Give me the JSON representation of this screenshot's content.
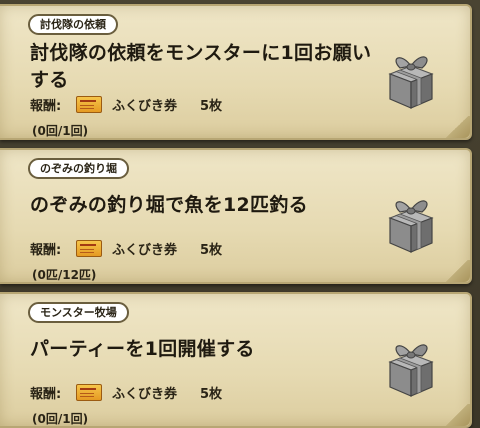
{
  "missions": [
    {
      "category": "討伐隊の依頼",
      "title": "討伐隊の依頼をモンスターに1回お願いする",
      "reward_label": "報酬:",
      "reward_icon": "ticket-icon",
      "reward_name": "ふくびき券",
      "reward_qty": "5枚",
      "progress": "(0回/1回)",
      "gift_icon": "gift-box-icon"
    },
    {
      "category": "のぞみの釣り堀",
      "title": "のぞみの釣り堀で魚を12匹釣る",
      "reward_label": "報酬:",
      "reward_icon": "ticket-icon",
      "reward_name": "ふくびき券",
      "reward_qty": "5枚",
      "progress": "(0匹/12匹)",
      "gift_icon": "gift-box-icon"
    },
    {
      "category": "モンスター牧場",
      "title": "パーティーを1回開催する",
      "reward_label": "報酬:",
      "reward_icon": "ticket-icon",
      "reward_name": "ふくびき券",
      "reward_qty": "5枚",
      "progress": "(0回/1回)",
      "gift_icon": "gift-box-icon"
    }
  ],
  "colors": {
    "card_bg": "#efe6c7",
    "card_border": "#b7a674",
    "badge_border": "#6a5e3e",
    "gift_gray": "#8a8a8a"
  }
}
